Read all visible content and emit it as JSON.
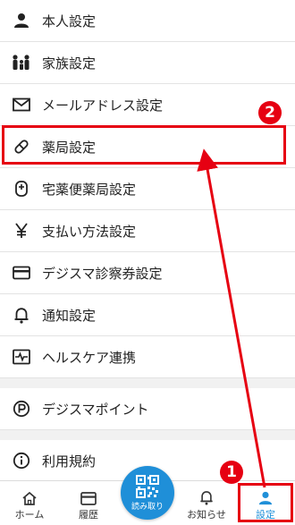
{
  "menu": {
    "items": [
      {
        "label": "本人設定",
        "icon": "person-icon"
      },
      {
        "label": "家族設定",
        "icon": "family-icon"
      },
      {
        "label": "メールアドレス設定",
        "icon": "mail-icon"
      },
      {
        "label": "薬局設定",
        "icon": "pill-icon"
      },
      {
        "label": "宅薬便薬局設定",
        "icon": "delivery-icon"
      },
      {
        "label": "支払い方法設定",
        "icon": "yen-icon"
      },
      {
        "label": "デジスマ診察券設定",
        "icon": "card-icon"
      },
      {
        "label": "通知設定",
        "icon": "bell-icon"
      },
      {
        "label": "ヘルスケア連携",
        "icon": "health-icon"
      },
      {
        "label": "デジスマポイント",
        "icon": "point-icon"
      },
      {
        "label": "利用規約",
        "icon": "info-icon"
      }
    ]
  },
  "annotations": {
    "step1": "1",
    "step2": "2",
    "color": "#e60012"
  },
  "tabbar": {
    "home": "ホーム",
    "history": "履歴",
    "scan": "読み取り",
    "notifications": "お知らせ",
    "settings": "設定",
    "accent": "#1f8fd8"
  }
}
